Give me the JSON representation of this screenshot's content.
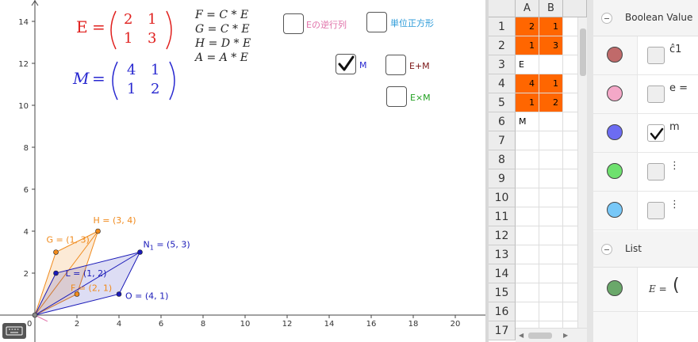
{
  "graphics": {
    "matrix_E": {
      "label": "E",
      "rows": [
        [
          "2",
          "1"
        ],
        [
          "1",
          "3"
        ]
      ],
      "color": "#e0201e"
    },
    "matrix_M": {
      "label": "M",
      "rows": [
        [
          "4",
          "1"
        ],
        [
          "1",
          "2"
        ]
      ],
      "color": "#2828d0"
    },
    "equations": [
      "F = C * E",
      "G = C * E",
      "H = D * E",
      "A = A * E"
    ],
    "checkboxes": [
      {
        "label": "Eの逆行列",
        "checked": false,
        "color": "#e070a8"
      },
      {
        "label": "単位正方形",
        "checked": false,
        "color": "#2a9ad8"
      },
      {
        "label": "M",
        "checked": true,
        "color": "#2828d0"
      },
      {
        "label": "E+M",
        "checked": false,
        "color": "#7a1414"
      },
      {
        "label": "E×M",
        "checked": false,
        "color": "#20a020"
      }
    ],
    "axes": {
      "x_ticks": [
        "2",
        "4",
        "6",
        "8",
        "10",
        "12",
        "14",
        "16",
        "18",
        "20"
      ],
      "y_ticks": [
        "2",
        "4",
        "6",
        "8",
        "10",
        "12",
        "14"
      ],
      "origin_label": "0"
    },
    "points": [
      {
        "label": "H = (3, 4)",
        "color": "#f08a1c"
      },
      {
        "label": "G = (1, 3)",
        "color": "#f08a1c"
      },
      {
        "label": "F = (2, 1)",
        "color": "#f08a1c"
      },
      {
        "label": "N",
        "sub": "1",
        "suffix": " = (5, 3)",
        "color": "#1a1ab8"
      },
      {
        "label": "L = (1, 2)",
        "color": "#1a1ab8"
      },
      {
        "label": "O = (4, 1)",
        "color": "#1a1ab8"
      }
    ],
    "colors": {
      "orange": "#f08a1c",
      "blue": "#1a1ab8",
      "axis": "#444444",
      "grid": "#999999"
    }
  },
  "spreadsheet": {
    "columns": [
      "A",
      "B"
    ],
    "rows": [
      "1",
      "2",
      "3",
      "4",
      "5",
      "6",
      "7",
      "8",
      "9",
      "10",
      "11",
      "12",
      "13",
      "14",
      "15",
      "16",
      "17"
    ],
    "cells": {
      "A1": "2",
      "B1": "1",
      "A2": "1",
      "B2": "3",
      "A3": "E",
      "A4": "4",
      "B4": "1",
      "A5": "1",
      "B5": "2",
      "A6": "M"
    },
    "highlight_color": "#ff6600"
  },
  "algebra": {
    "sections": [
      {
        "title": "Boolean Value",
        "top": 0
      },
      {
        "title": "List",
        "top": 292
      }
    ],
    "boolean_rows": [
      {
        "color": "#c06a6a",
        "checked": false,
        "tag": "ĉ1"
      },
      {
        "color": "#f4a8c8",
        "checked": false,
        "tag": "e ="
      },
      {
        "color": "#6c6cf2",
        "checked": true,
        "tag": "m"
      },
      {
        "color": "#6ee06e",
        "checked": false,
        "tag": ""
      },
      {
        "color": "#78c8f8",
        "checked": false,
        "tag": ""
      }
    ],
    "list_row": {
      "color": "#6aa86a",
      "text": "E ="
    }
  }
}
